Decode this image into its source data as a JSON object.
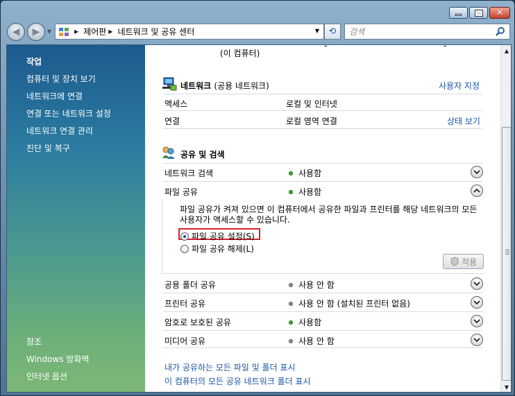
{
  "address": {
    "breadcrumbs": [
      "제어판",
      "네트워크 및 공유 센터"
    ]
  },
  "search": {
    "placeholder": "검색"
  },
  "taskpane": {
    "tasks_heading": "작업",
    "tasks": [
      "컴퓨터 및 장치 보기",
      "네트워크에 연결",
      "연결 또는 네트워크 설정",
      "네트워크 연결 관리",
      "진단 및 복구"
    ],
    "see_also_heading": "참조",
    "see_also": [
      "Windows 방화벽",
      "인터넷 옵션"
    ]
  },
  "main": {
    "partial_text": "(이 컴퓨터)",
    "network": {
      "title": "네트워크",
      "subtitle": "(공용 네트워크)",
      "customize_link": "사용자 지정",
      "rows": [
        {
          "label": "액세스",
          "value": "로컬 및 인터넷",
          "link": ""
        },
        {
          "label": "연결",
          "value": "로컬 영역 연결",
          "link": "상태 보기"
        }
      ]
    },
    "sharing": {
      "title": "공유 및 검색",
      "rows": [
        {
          "label": "네트워크 검색",
          "status": "사용함",
          "on": true,
          "expanded": false
        },
        {
          "label": "파일 공유",
          "status": "사용함",
          "on": true,
          "expanded": true
        },
        {
          "label": "공용 폴더 공유",
          "status": "사용 안 함",
          "on": false,
          "expanded": false
        },
        {
          "label": "프린터 공유",
          "status": "사용 안 함 (설치된 프린터 없음)",
          "on": false,
          "expanded": false
        },
        {
          "label": "암호로 보호된 공유",
          "status": "사용함",
          "on": true,
          "expanded": false
        },
        {
          "label": "미디어 공유",
          "status": "사용 안 함",
          "on": false,
          "expanded": false
        }
      ],
      "file_sharing_detail": {
        "description": "파일 공유가 켜져 있으면 이 컴퓨터에서 공유한 파일과 프린터를 해당 네트워크의 모든 사용자가 액세스할 수 있습니다.",
        "option_on": "파일 공유 설정(S)",
        "option_off": "파일 공유 해제(L)",
        "selected": "on",
        "apply_label": "적용"
      }
    },
    "bottom_links": [
      "내가 공유하는 모든 파일 및 폴더 표시",
      "이 컴퓨터의 모든 공유 네트워크 폴더 표시"
    ]
  },
  "colors": {
    "link": "#1a56a8",
    "status_on": "#3aa832",
    "status_off": "#8c8c8c",
    "highlight_border": "#d8202a"
  }
}
